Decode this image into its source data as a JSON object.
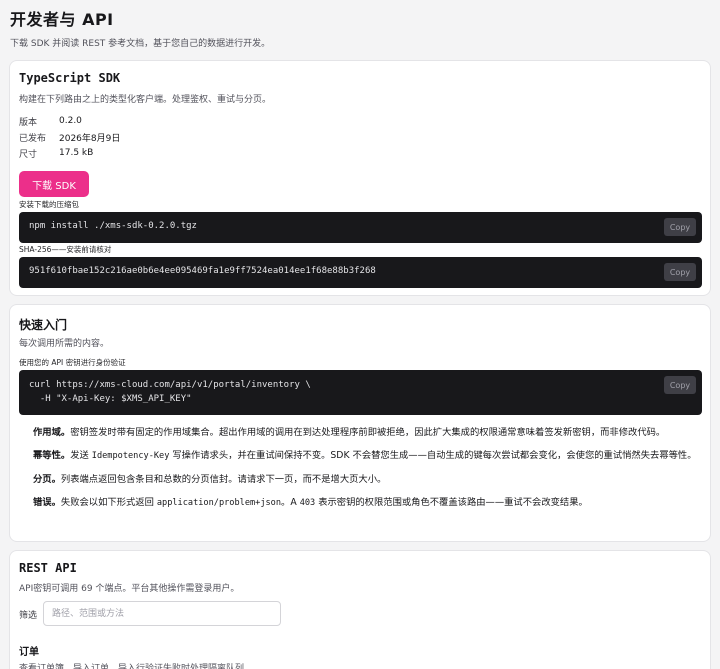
{
  "header": {
    "title": "开发者与 API",
    "subtitle": "下载 SDK 并阅读 REST 参考文档，基于您自己的数据进行开发。"
  },
  "sdk": {
    "title": "TypeScript SDK",
    "description": "构建在下列路由之上的类型化客户端。处理鉴权、重试与分页。",
    "meta": [
      {
        "key": "版本",
        "value": "0.2.0"
      },
      {
        "key": "已发布",
        "value": "2026年8月9日"
      },
      {
        "key": "尺寸",
        "value": "17.5 kB"
      }
    ],
    "download_label": "下载 SDK",
    "install_label": "安装下载的压缩包",
    "install_command": "npm install ./xms-sdk-0.2.0.tgz",
    "sha_label": "SHA-256——安装前请核对",
    "sha_value": "951f610fbae152c216ae0b6e4ee095469fa1e9ff7524ea014ee1f68e88b3f268",
    "copy_label": "Copy",
    "accent_color": "#ec2f8a"
  },
  "quickstart": {
    "title": "快速入门",
    "description": "每次调用所需的内容。",
    "auth_label": "使用您的 API 密钥进行身份验证",
    "code_line1": "curl https://xms-cloud.com/api/v1/portal/inventory \\",
    "code_line2": "  -H \"X-Api-Key: $XMS_API_KEY\"",
    "copy_label": "Copy",
    "notes": {
      "scope_title": "作用域。",
      "scope_text": "密钥签发时带有固定的作用域集合。超出作用域的调用在到达处理程序前即被拒绝，因此扩大集成的权限通常意味着签发新密钥，而非修改代码。",
      "idem_title": "幂等性。",
      "idem_pre": "发送",
      "idem_code": "Idempotency-Key",
      "idem_post": "写操作请求头，并在重试间保持不变。SDK 不会替您生成——自动生成的键每次尝试都会变化，会使您的重试悄然失去幂等性。",
      "page_title": "分页。",
      "page_text": "列表端点返回包含条目和总数的分页信封。请请求下一页，而不是增大页大小。",
      "err_title": "错误。",
      "err_pre": "失败会以如下形式返回",
      "err_code1": "application/problem+json",
      "err_mid": "。A",
      "err_code2": "403",
      "err_post": "表示密钥的权限范围或角色不覆盖该路由——重试不会改变结果。"
    }
  },
  "rest": {
    "title": "REST API",
    "description": "API密钥可调用 69 个端点。平台其他操作需登录用户。",
    "filter_label": "筛选",
    "filter_placeholder": "路径、范围或方法",
    "section_title": "订单",
    "section_desc": "查看订单簿、导入订单、导入行验证失败时处理隔离队列。"
  }
}
